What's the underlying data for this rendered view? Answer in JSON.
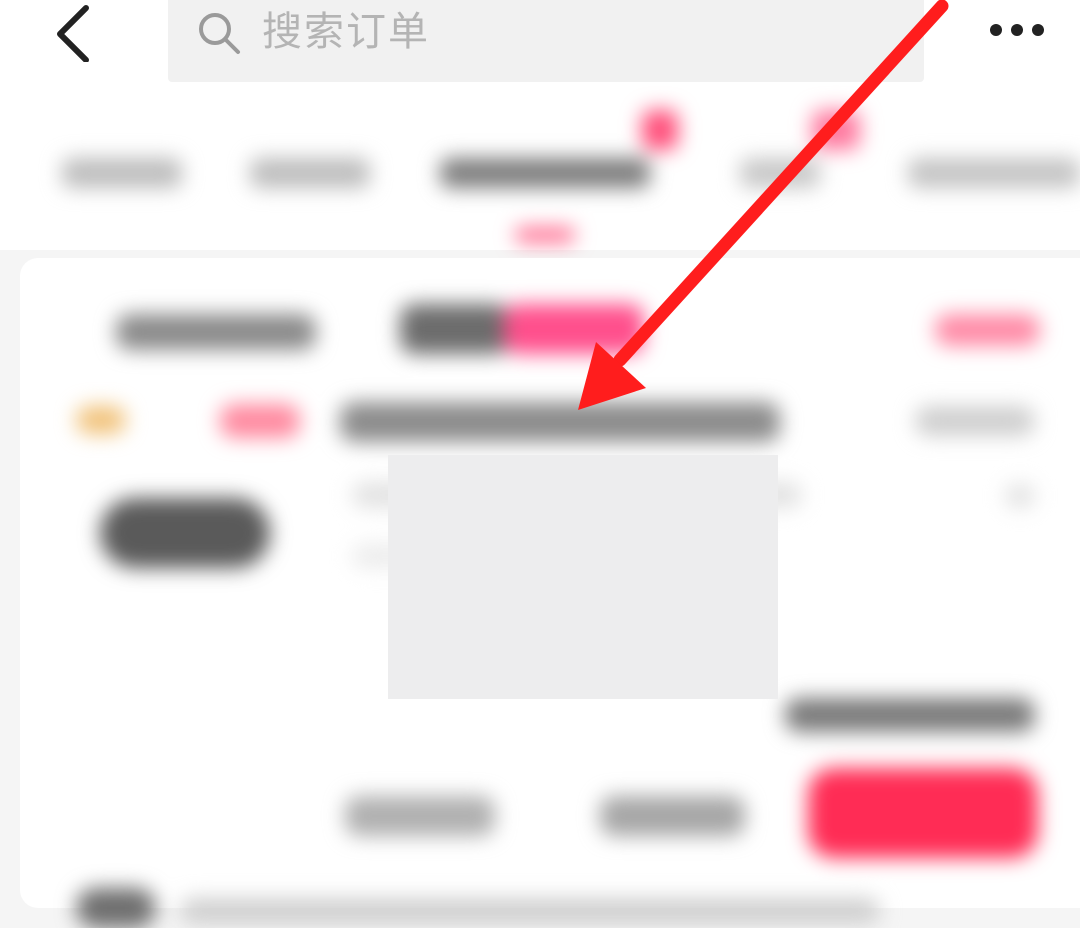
{
  "header": {
    "back_icon": "chevron-left-icon",
    "search": {
      "icon": "search-icon",
      "placeholder": "搜索订单"
    },
    "more_icon": "more-dots-icon"
  },
  "colors": {
    "accent": "#ff2c55",
    "arrow": "#ff1d1d",
    "placeholder": "#b4b4b4"
  }
}
